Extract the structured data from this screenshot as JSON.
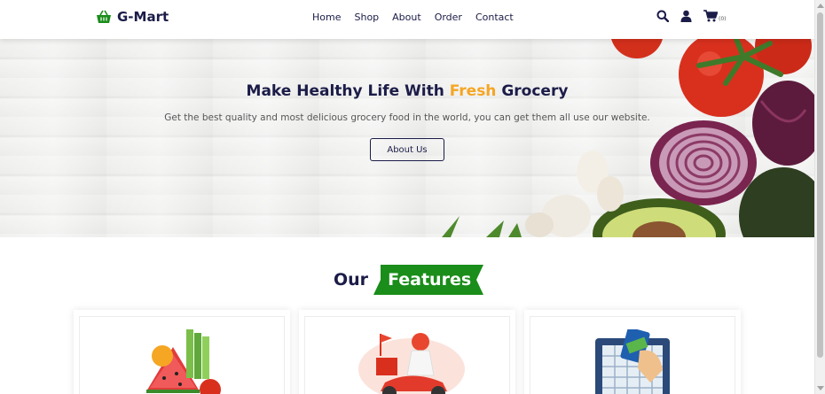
{
  "brand": {
    "name": "G-Mart",
    "icon": "basket-icon",
    "color": "#1a8d1a"
  },
  "nav": {
    "items": [
      "Home",
      "Shop",
      "About",
      "Order",
      "Contact"
    ]
  },
  "header_icons": {
    "search": "search-icon",
    "user": "user-icon",
    "cart": "cart-icon",
    "cart_count": "(0)"
  },
  "hero": {
    "title_start": "Make Healthy Life With ",
    "title_accent": "Fresh",
    "title_end": " Grocery",
    "subtitle": "Get the best quality and most delicious grocery food in the world, you can get them all use our website.",
    "button_label": "About Us",
    "accent_color": "#f5a623"
  },
  "features": {
    "title_plain": "Our",
    "title_badge": "Features",
    "badge_color": "#1a8d1a",
    "cards": [
      {
        "icon": "vegetables-icon"
      },
      {
        "icon": "delivery-scooter-icon"
      },
      {
        "icon": "card-payment-icon"
      }
    ]
  }
}
